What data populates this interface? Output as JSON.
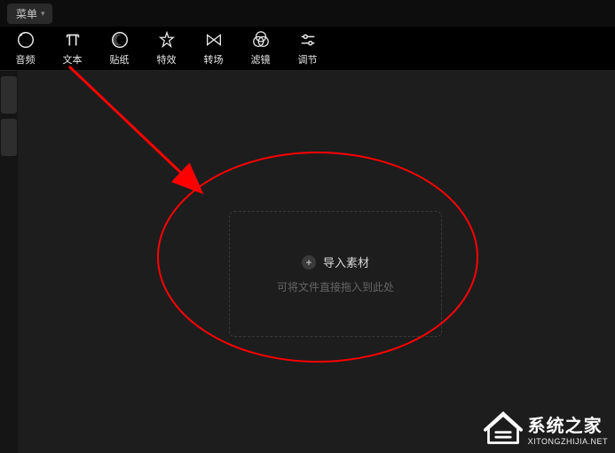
{
  "menu_label": "菜单",
  "toolbar": [
    {
      "id": "audio-tab",
      "label": "音频",
      "icon": "rewind-icon"
    },
    {
      "id": "text-tab",
      "label": "文本",
      "icon": "text-icon"
    },
    {
      "id": "sticker-tab",
      "label": "贴纸",
      "icon": "moon-icon"
    },
    {
      "id": "effects-tab",
      "label": "特效",
      "icon": "star-icon"
    },
    {
      "id": "transition-tab",
      "label": "转场",
      "icon": "bowtie-icon"
    },
    {
      "id": "filter-tab",
      "label": "滤镜",
      "icon": "venn-icon"
    },
    {
      "id": "adjust-tab",
      "label": "调节",
      "icon": "sliders-icon"
    }
  ],
  "dropzone": {
    "import_label": "导入素材",
    "hint_label": "可将文件直接拖入到此处"
  },
  "watermark": {
    "name_cn": "系统之家",
    "name_en": "XITONGZHIJIA.NET"
  }
}
